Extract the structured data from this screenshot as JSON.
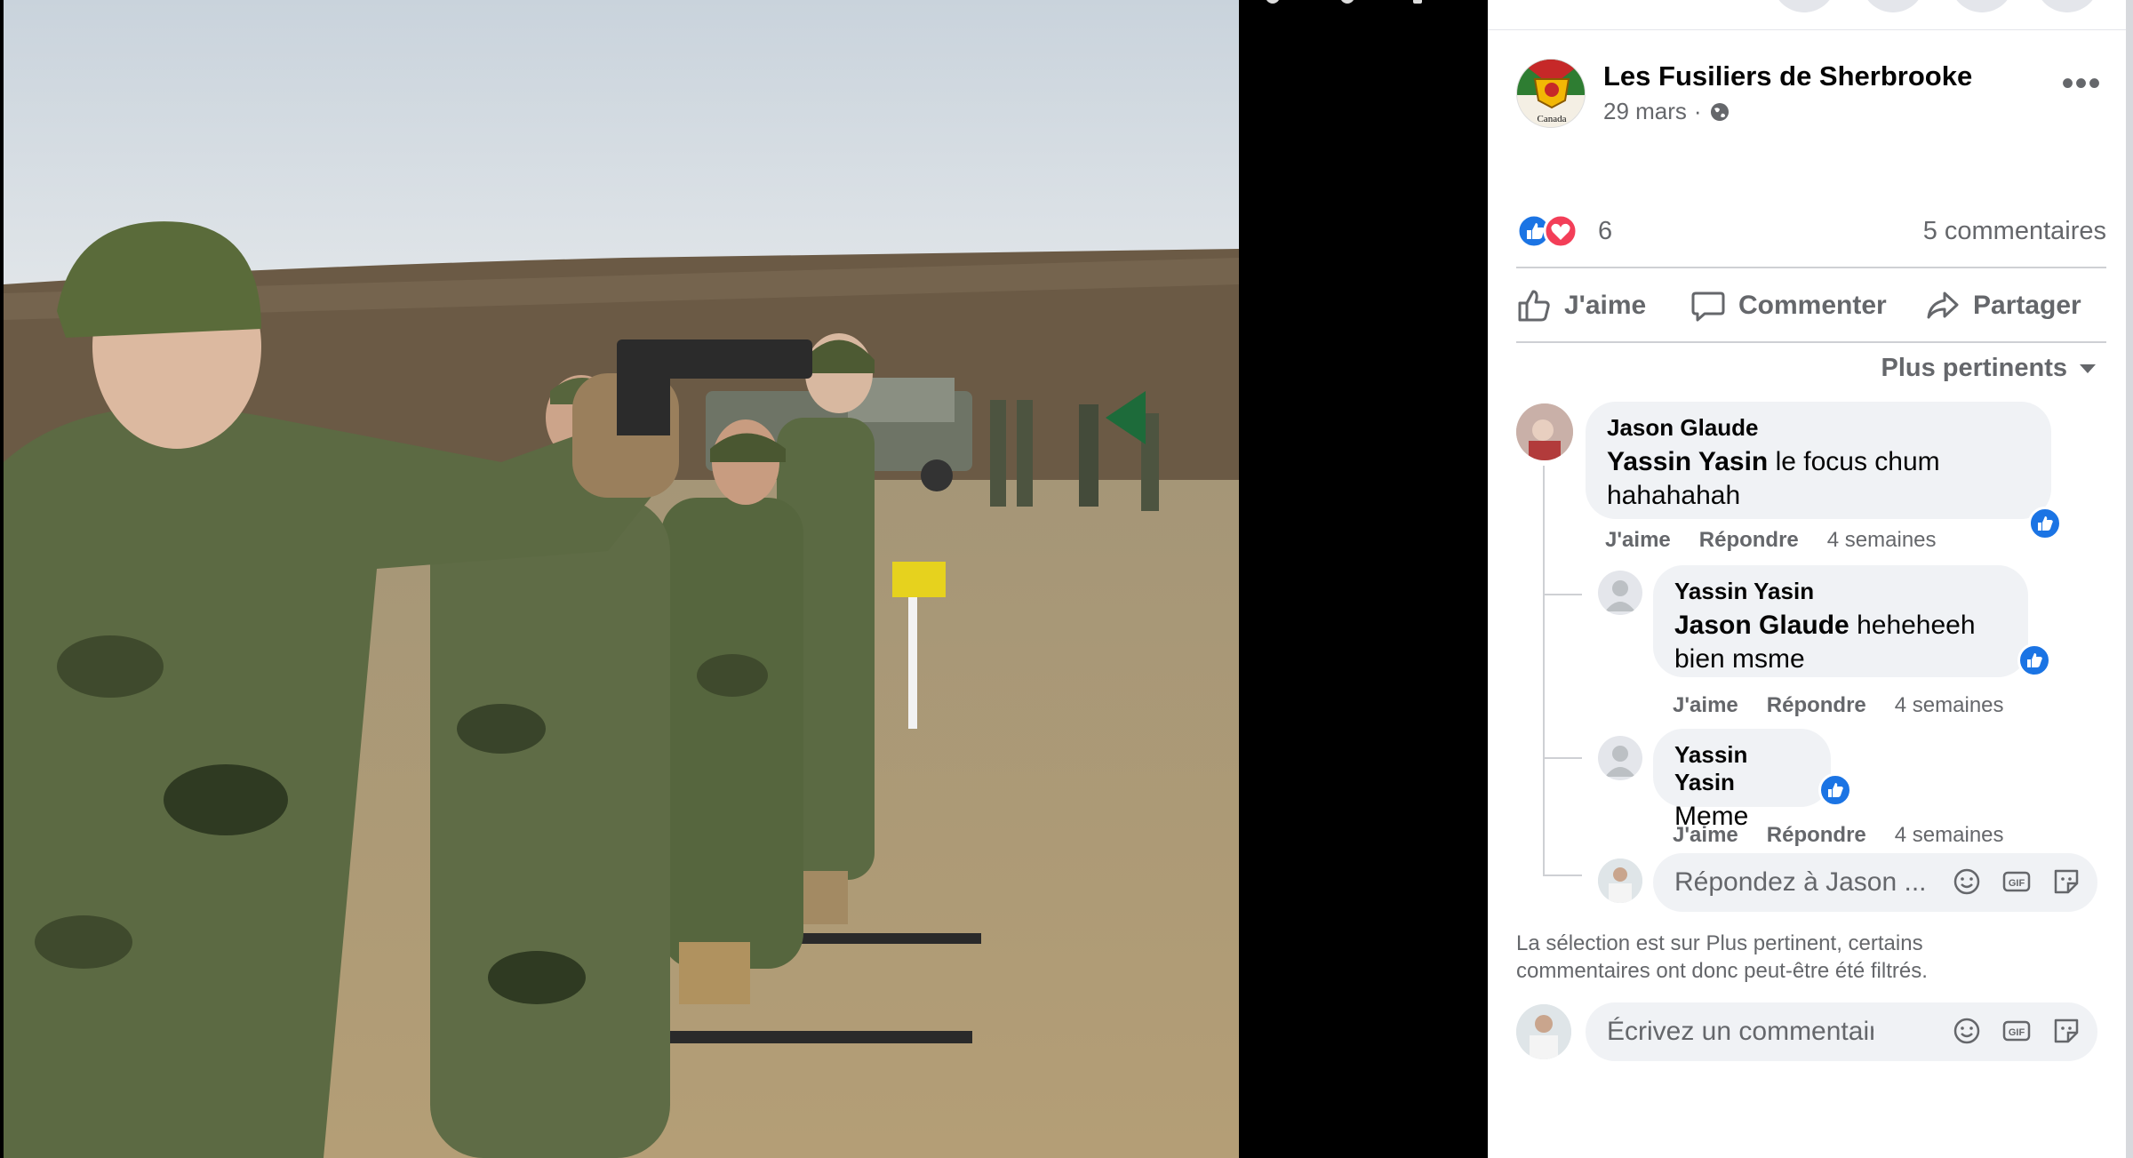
{
  "post": {
    "page_name": "Les Fusiliers de Sherbrooke",
    "date": "29 mars",
    "meta_separator": "·",
    "avatar_caption": "Canada",
    "more_label": "•••"
  },
  "reactions": {
    "count": "6",
    "comments_label": "5 commentaires",
    "types": [
      "like-icon",
      "love-icon"
    ]
  },
  "actions": {
    "like": "J'aime",
    "comment": "Commenter",
    "share": "Partager"
  },
  "sort": {
    "label": "Plus pertinents"
  },
  "comments": [
    {
      "author": "Jason Glaude",
      "mention": "Yassin Yasin",
      "text_line1": " le focus chum",
      "text_line2": "hahahahah",
      "like": "J'aime",
      "reply": "Répondre",
      "time": "4 semaines",
      "replies": [
        {
          "author": "Yassin Yasin",
          "mention": "Jason Glaude",
          "text_line1": " heheheeh",
          "text_line2": "bien msme",
          "like": "J'aime",
          "reply": "Répondre",
          "time": "4 semaines"
        },
        {
          "author": "Yassin Yasin",
          "text_line1": "Meme",
          "like": "J'aime",
          "reply": "Répondre",
          "time": "4 semaines"
        }
      ]
    }
  ],
  "reply_box": {
    "placeholder": "Répondez à Jason ..."
  },
  "filter_note": {
    "line1": "La sélection est sur Plus pertinent, certains",
    "line2": "commentaires ont donc peut-être été filtrés."
  },
  "comment_box": {
    "placeholder": "Écrivez un commentaire..."
  },
  "box_icons": [
    "emoji-icon",
    "gif-icon",
    "sticker-icon"
  ],
  "colors": {
    "accent": "#1b74e4",
    "love": "#f33e58",
    "muted_text": "#65676b",
    "bubble": "#f0f2f5"
  }
}
